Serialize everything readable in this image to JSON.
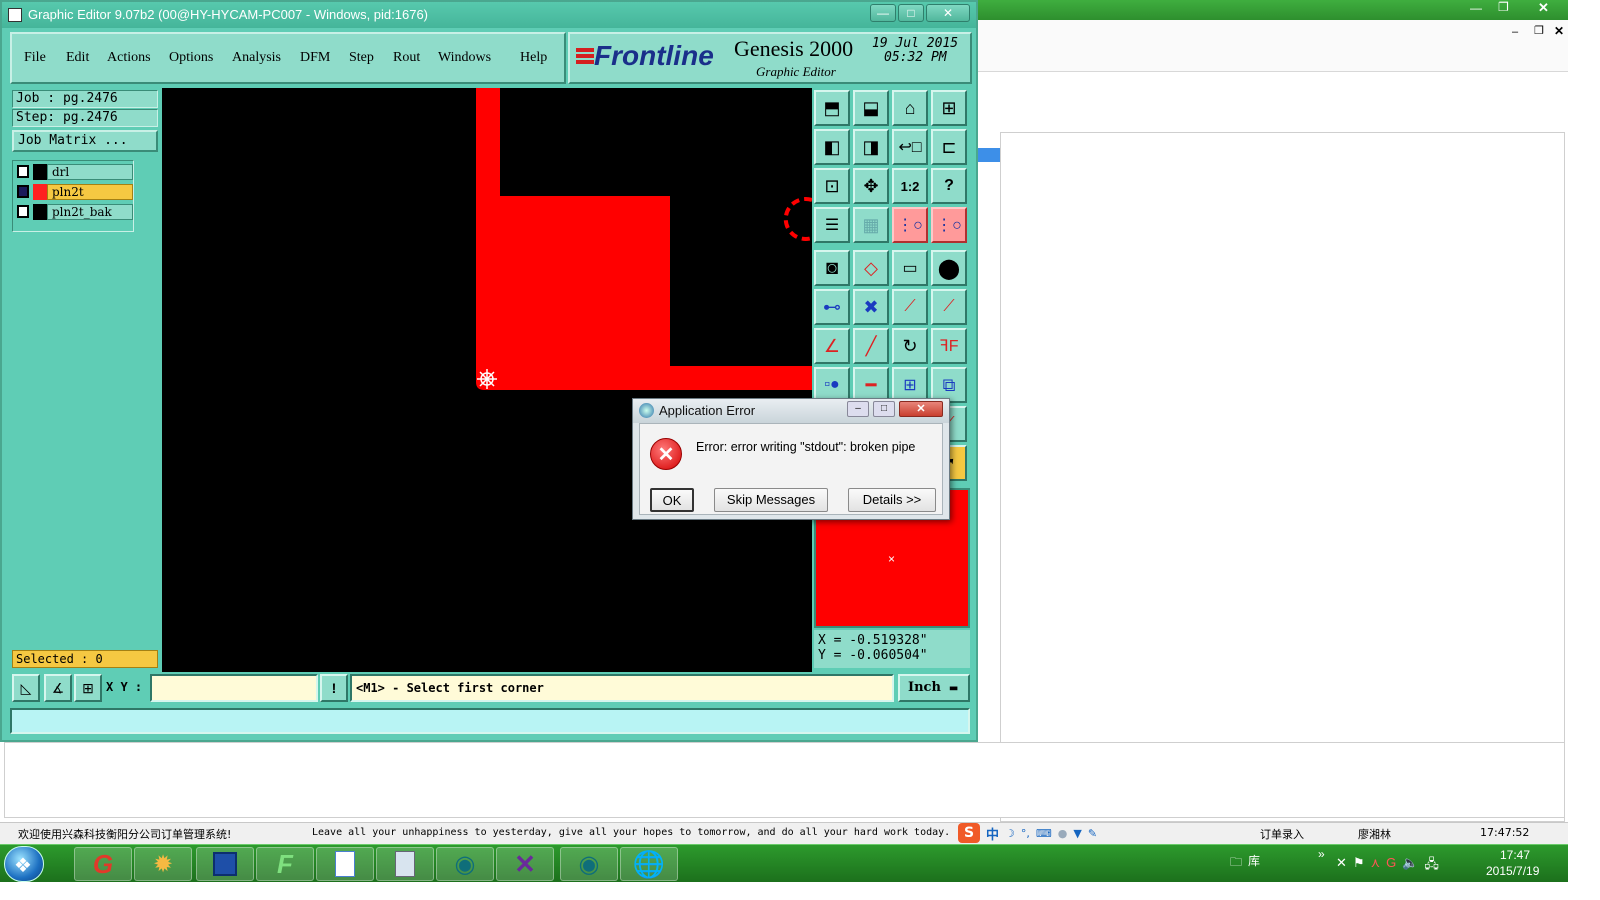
{
  "main_window": {
    "title": "Graphic Editor 9.07b2 (00@HY-HYCAM-PC007 - Windows, pid:1676)",
    "menu": [
      "File",
      "Edit",
      "Actions",
      "Options",
      "Analysis",
      "DFM",
      "Step",
      "Rout",
      "Windows",
      "Help"
    ],
    "brand": {
      "logo": "Frontline",
      "product": "Genesis 2000",
      "subtitle": "Graphic Editor",
      "date": "19 Jul 2015",
      "time": "05:32 PM"
    },
    "job": "Job : pg.2476",
    "step": "Step: pg.2476",
    "job_matrix_button": "Job Matrix ...",
    "layers": [
      {
        "name": "drl",
        "color": "#000000",
        "active": false
      },
      {
        "name": "pln2t",
        "color": "#ff2020",
        "active": true
      },
      {
        "name": "pln2t_bak",
        "color": "#000000",
        "active": false
      }
    ],
    "selected": "Selected : 0",
    "coords": {
      "x": "X = -0.519328\"",
      "y": "Y = -0.060504\""
    },
    "xy_label": "X Y :",
    "xy_input_value": "",
    "prompt": "<M1> - Select first corner",
    "units": "Inch",
    "message": "",
    "colors": {
      "panel": "#5fcdb5",
      "field": "#8fdcca",
      "feature": "#ff0000",
      "canvas": "#000000"
    }
  },
  "dialog": {
    "title": "Application Error",
    "message": "Error: error writing \"stdout\": broken pipe",
    "ok": "OK",
    "skip": "Skip Messages",
    "details": "Details >>"
  },
  "background_app": {
    "status_left": "欢迎使用兴森科技衡阳分公司订单管理系统!",
    "status_motto": "Leave all your unhappiness to yesterday, give all your hopes to tomorrow, and do all your hard work today.",
    "status_module": "订单录入",
    "status_user": "廖湘林",
    "status_time": "17:47:52"
  },
  "taskbar": {
    "time": "17:47",
    "date": "2015/7/19",
    "library_label": "库",
    "chevron": "»"
  }
}
